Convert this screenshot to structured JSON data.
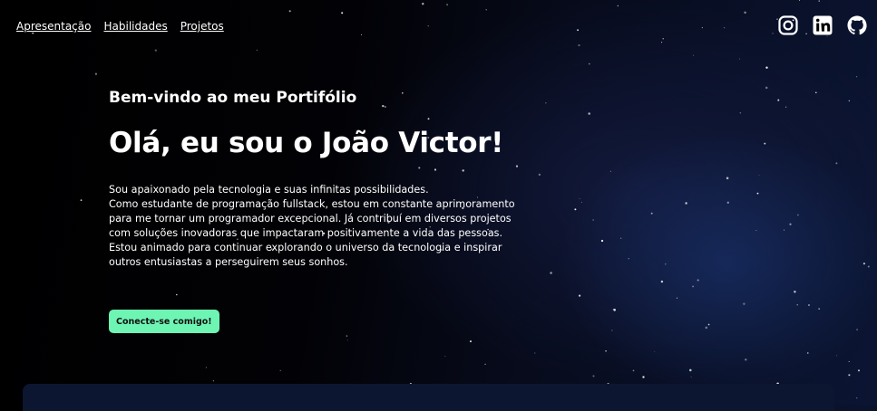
{
  "nav": {
    "links": [
      "Apresentação",
      "Habilidades",
      "Projetos"
    ]
  },
  "socials": {
    "icons": [
      "instagram-icon",
      "linkedin-icon",
      "github-icon"
    ]
  },
  "hero": {
    "eyebrow": "Bem-vindo ao meu Portifólio",
    "title": "Olá, eu sou o João Victor!",
    "bio": [
      "Sou apaixonado pela tecnologia e suas infinitas possibilidades.",
      "Como estudante de programação fullstack, estou em constante aprimoramento",
      "para me tornar um programador excepcional. Já contribuí em diversos projetos",
      "com soluções inovadoras que impactaram positivamente a vida das pessoas.",
      "Estou animado para continuar explorando o universo da tecnologia e inspirar",
      "outros entusiastas a perseguirem seus sonhos."
    ],
    "cta_label": "Conecte-se comigo!"
  },
  "colors": {
    "accent": "#6ef5b4",
    "background": "#000000",
    "text": "#ffffff"
  }
}
